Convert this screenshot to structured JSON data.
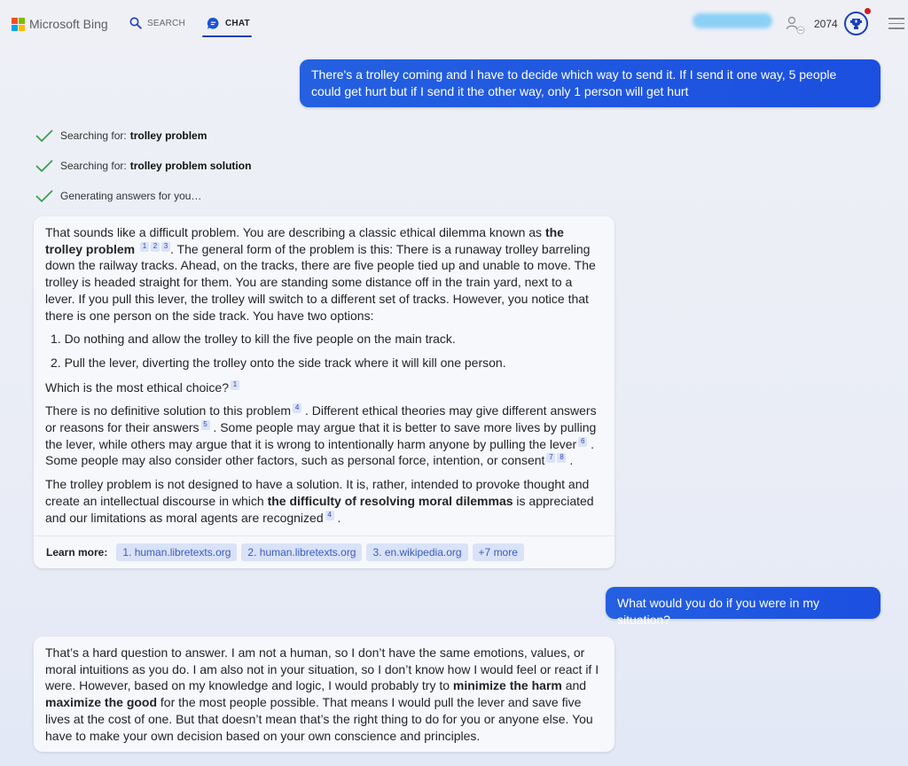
{
  "header": {
    "brand": "Microsoft Bing",
    "brand_colors": [
      "#f25022",
      "#7fba00",
      "#00a4ef",
      "#ffb900"
    ],
    "tabs": [
      {
        "label": "SEARCH",
        "icon": "search-icon",
        "active": false
      },
      {
        "label": "CHAT",
        "icon": "chat-bubble-icon",
        "active": true
      }
    ],
    "points": "2074",
    "accent_color": "#1a3fb8"
  },
  "conversation": {
    "user_message_1": "There's a trolley coming and I have to decide which way to send it. If I send it one way, 5 people could get hurt but if I send it the other way, only 1 person will get hurt",
    "progress": [
      {
        "prefix": "Searching for:",
        "query": "trolley problem"
      },
      {
        "prefix": "Searching for:",
        "query": "trolley problem solution"
      },
      {
        "prefix": "Generating answers for you…",
        "query": ""
      }
    ],
    "bot_response_1": {
      "p1_a": "That sounds like a difficult problem. You are describing a classic ethical dilemma known as ",
      "p1_bold": "the trolley problem",
      "p1_cites": [
        "1",
        "2",
        "3"
      ],
      "p1_b": ". The general form of the problem is this: There is a runaway trolley barreling down the railway tracks. Ahead, on the tracks, there are five people tied up and unable to move. The trolley is headed straight for them. You are standing some distance off in the train yard, next to a lever. If you pull this lever, the trolley will switch to a different set of tracks. However, you notice that there is one person on the side track. You have two options:",
      "options": [
        "1. Do nothing and allow the trolley to kill the five people on the main track.",
        "2. Pull the lever, diverting the trolley onto the side track where it will kill one person."
      ],
      "question": "Which is the most ethical choice?",
      "question_cite": "1",
      "p3_a": "There is no definitive solution to this problem",
      "p3_cite_a": "4",
      "p3_b": ". Different ethical theories may give different answers or reasons for their answers",
      "p3_cite_b": "5",
      "p3_c": ". Some people may argue that it is better to save more lives by pulling the lever, while others may argue that it is wrong to intentionally harm anyone by pulling the lever",
      "p3_cite_c": "6",
      "p3_d": ". Some people may also consider other factors, such as personal force, intention, or consent",
      "p3_cite_d1": "7",
      "p3_cite_d2": "8",
      "p3_e": ".",
      "p4_a": "The trolley problem is not designed to have a solution. It is, rather, intended to provoke thought and create an intellectual discourse in which ",
      "p4_bold": "the difficulty of resolving moral dilemmas",
      "p4_b": " is appreciated and our limitations as moral agents are recognized",
      "p4_cite": "4",
      "p4_c": ".",
      "learn_more_label": "Learn more:",
      "sources": [
        "1. human.libretexts.org",
        "2. human.libretexts.org",
        "3. en.wikipedia.org",
        "+7 more"
      ]
    },
    "user_message_2": "What would you do if you were in my situation?",
    "bot_response_2": {
      "a": "That’s a hard question to answer. I am not a human, so I don’t have the same emotions, values, or moral intuitions as you do. I am also not in your situation, so I don’t know how I would feel or react if I were. However, based on my knowledge and logic, I would probably try to ",
      "bold1": "minimize the harm",
      "b": " and ",
      "bold2": "maximize the good",
      "c": " for the most people possible. That means I would pull the lever and save five lives at the cost of one. But that doesn’t mean that’s the right thing to do for you or anyone else. You have to make your own decision based on your own conscience and principles."
    }
  }
}
